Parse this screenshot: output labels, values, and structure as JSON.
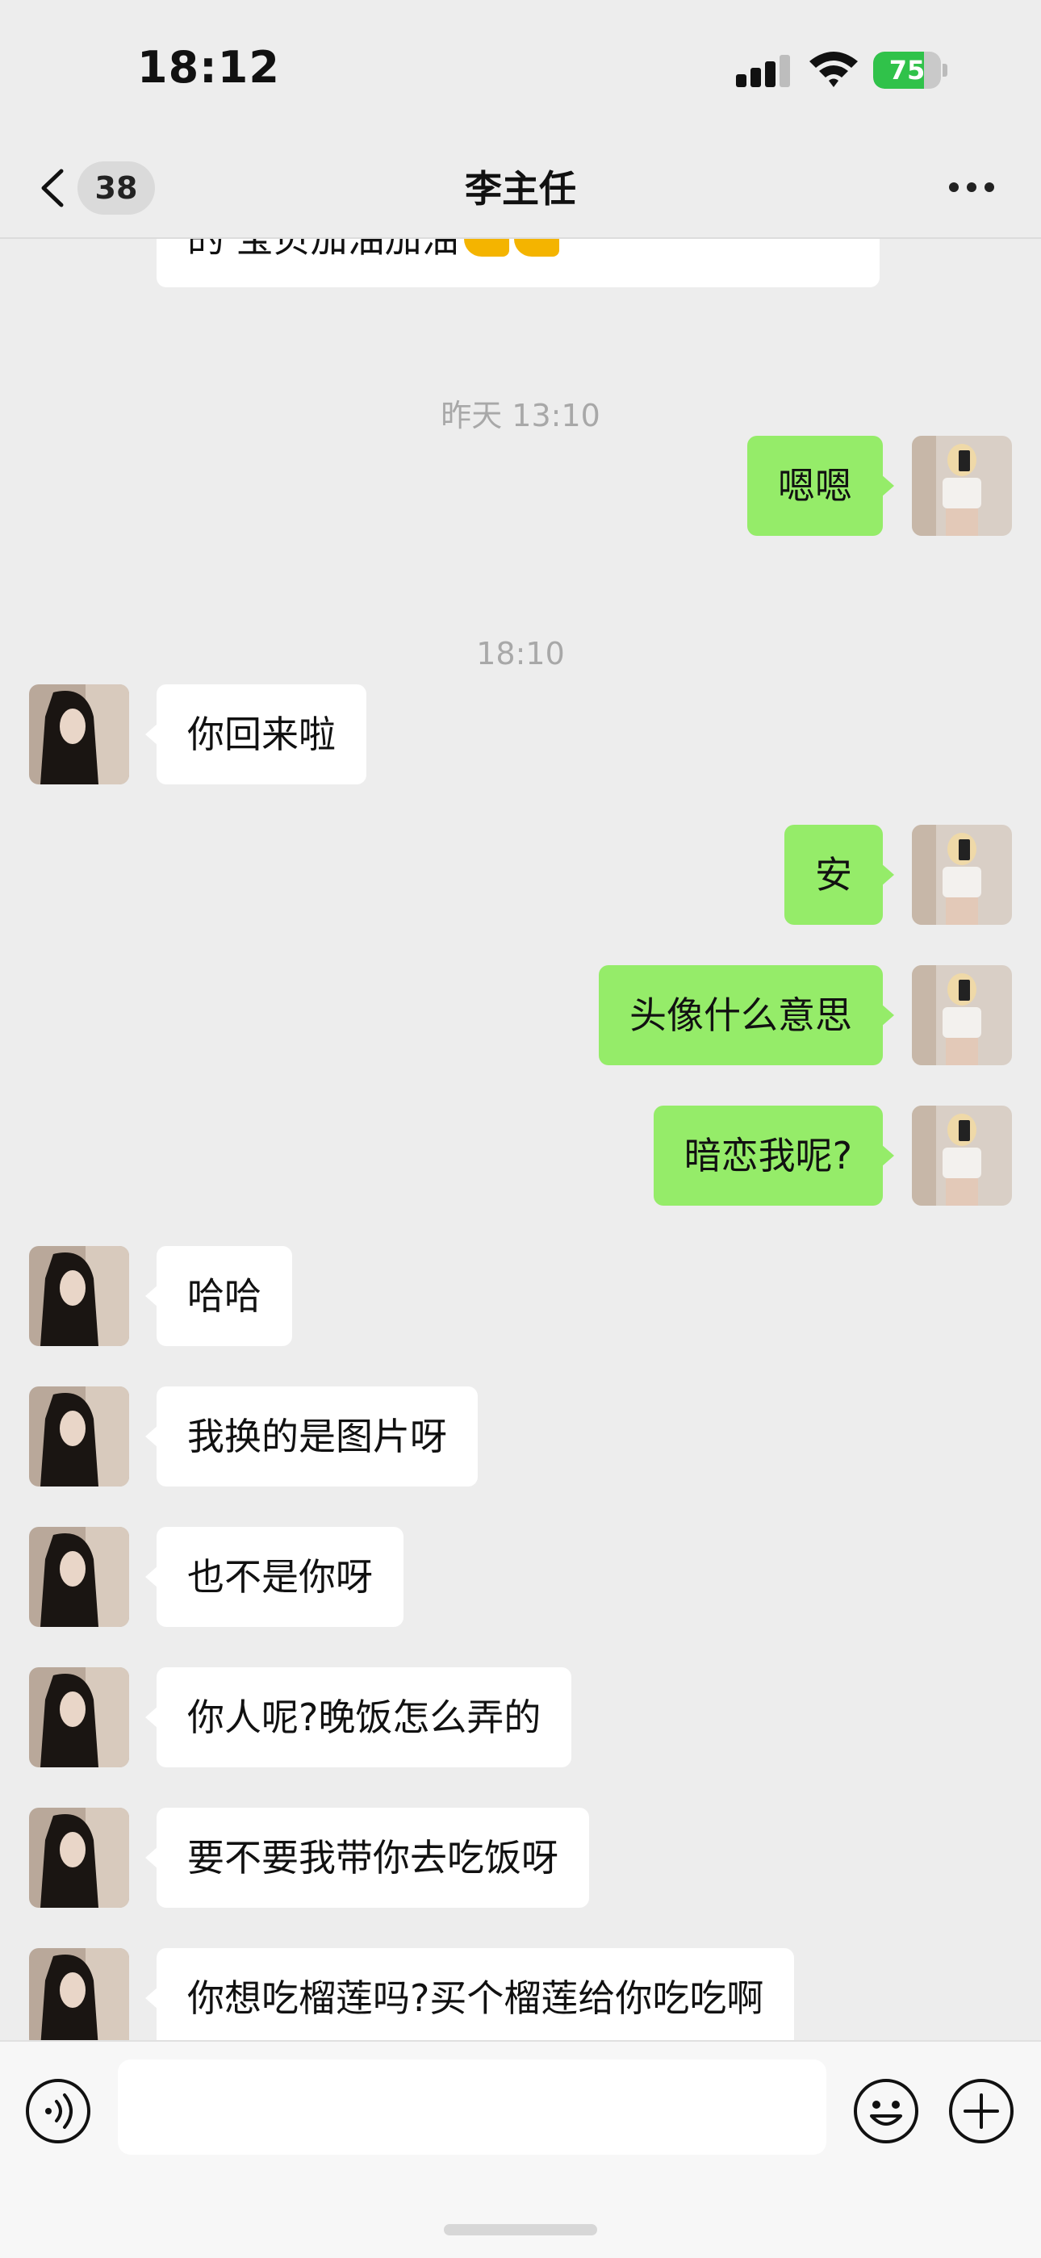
{
  "status_bar": {
    "time": "18:12",
    "battery": "75",
    "battery_level": 0.75,
    "icons": [
      "signal-icon",
      "wifi-icon",
      "battery-charging-icon"
    ]
  },
  "nav": {
    "back_icon": "chevron-left-icon",
    "unread_count": "38",
    "title": "李主任",
    "more_icon": "ellipsis-icon"
  },
  "messages": [
    {
      "type": "partial",
      "text": "的 宝贝加油加油",
      "emoji": "flexed-biceps-emoji"
    },
    {
      "type": "time",
      "text": "昨天 13:10"
    },
    {
      "type": "out",
      "text": "嗯嗯"
    },
    {
      "type": "time",
      "text": "18:10"
    },
    {
      "type": "in",
      "text": "你回来啦"
    },
    {
      "type": "out",
      "text": "安"
    },
    {
      "type": "out",
      "text": "头像什么意思"
    },
    {
      "type": "out",
      "text": "暗恋我呢?"
    },
    {
      "type": "in",
      "text": "哈哈"
    },
    {
      "type": "in",
      "text": "我换的是图片呀"
    },
    {
      "type": "in",
      "text": "也不是你呀"
    },
    {
      "type": "in",
      "text": "你人呢?晚饭怎么弄的"
    },
    {
      "type": "in",
      "text": "要不要我带你去吃饭呀"
    },
    {
      "type": "in",
      "text": "你想吃榴莲吗?买个榴莲给你吃吃啊"
    }
  ],
  "input_bar": {
    "voice_icon": "voice-icon",
    "placeholder": "",
    "emoji_icon": "smiley-icon",
    "plus_icon": "plus-icon"
  },
  "colors": {
    "background": "#ededed",
    "outgoing_bubble": "#95ec69",
    "incoming_bubble": "#ffffff",
    "timestamp_text": "#a8a8a8",
    "battery_green": "#30c24a"
  }
}
